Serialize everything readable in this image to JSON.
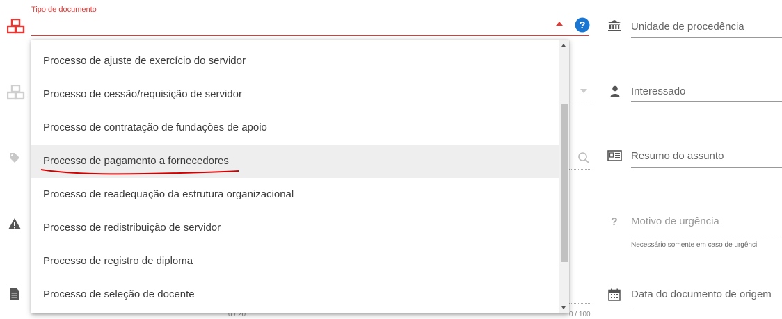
{
  "tipo_documento": {
    "label": "Tipo de documento",
    "options": [
      "Processo de ajuste de exercício do servidor",
      "Processo de cessão/requisição de servidor",
      "Processo de contratação de fundações de apoio",
      "Processo de pagamento a fornecedores",
      "Processo de readequação da estrutura organizacional",
      "Processo de redistribuição de servidor",
      "Processo de registro de diploma",
      "Processo de seleção de docente"
    ],
    "hovered_option": "Processo de pagamento a fornecedores"
  },
  "help_icon": {
    "glyph": "?"
  },
  "right_fields": {
    "unidade": "Unidade de procedência",
    "interessado": "Interessado",
    "resumo": "Resumo do assunto",
    "motivo": "Motivo de urgência",
    "motivo_hint": "Necessário somente em caso de urgênci",
    "data_origem": "Data do documento de origem"
  },
  "counters": {
    "left": "0 / 20",
    "right": "0 / 100"
  },
  "colors": {
    "accent": "#e53935",
    "help": "#1976d2",
    "hover": "#eeeeee",
    "annotation": "#d50000"
  },
  "icons": [
    "boxes-icon-red",
    "boxes-icon-grey",
    "tag-icon",
    "warning-icon",
    "document-icon",
    "bank-icon",
    "person-icon",
    "id-card-icon",
    "question-icon",
    "calendar-icon",
    "search-icon",
    "chevron-down-icon",
    "chevron-up-icon"
  ]
}
